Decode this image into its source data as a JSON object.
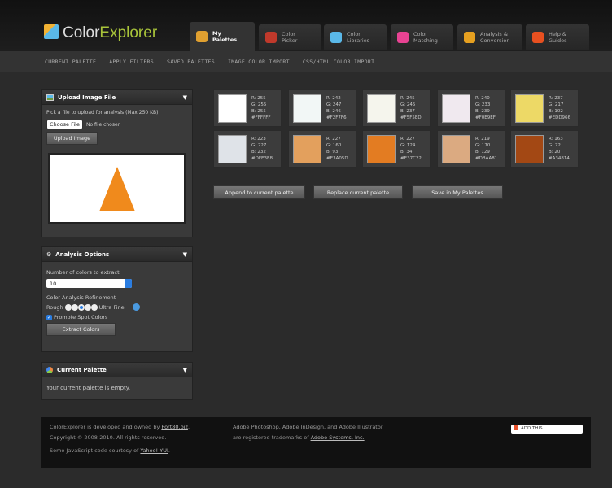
{
  "app": {
    "logo_a": "Color",
    "logo_b": "Explorer"
  },
  "tabs": [
    {
      "l1": "My",
      "l2": "Palettes",
      "color": "#e0a030"
    },
    {
      "l1": "Color",
      "l2": "Picker",
      "color": "#c0392b"
    },
    {
      "l1": "Color",
      "l2": "Libraries",
      "color": "#5ab8e8"
    },
    {
      "l1": "Color",
      "l2": "Matching",
      "color": "#e84393"
    },
    {
      "l1": "Analysis &",
      "l2": "Conversion",
      "color": "#e6a020"
    },
    {
      "l1": "Help &",
      "l2": "Guides",
      "color": "#e85020"
    }
  ],
  "subnav": [
    "CURRENT PALETTE",
    "APPLY FILTERS",
    "SAVED PALETTES",
    "IMAGE COLOR IMPORT",
    "CSS/HTML COLOR IMPORT"
  ],
  "upload": {
    "title": "Upload Image File",
    "hint": "Pick a file to upload for analysis (Max 250 KB)",
    "choose": "Choose File",
    "nofile": "No file chosen",
    "button": "Upload Image"
  },
  "analysis": {
    "title": "Analysis Options",
    "num_label": "Number of colors to extract",
    "num_value": "10",
    "refine_label": "Color Analysis Refinement",
    "rough": "Rough",
    "fine": "Ultra Fine",
    "refine_level": 3,
    "promote": "Promote Spot Colors",
    "extract": "Extract Colors"
  },
  "current": {
    "title": "Current Palette",
    "empty": "Your current palette is empty."
  },
  "swatches": [
    {
      "r": "R: 255",
      "g": "G: 255",
      "b": "B: 255",
      "hex": "#FFFFFF",
      "color": "#FFFFFF"
    },
    {
      "r": "R: 242",
      "g": "G: 247",
      "b": "B: 246",
      "hex": "#F2F7F6",
      "color": "#F2F7F6"
    },
    {
      "r": "R: 245",
      "g": "G: 245",
      "b": "B: 237",
      "hex": "#F5F5ED",
      "color": "#F5F5ED"
    },
    {
      "r": "R: 240",
      "g": "G: 233",
      "b": "B: 239",
      "hex": "#F0E9EF",
      "color": "#F0E9EF"
    },
    {
      "r": "R: 237",
      "g": "G: 217",
      "b": "B: 102",
      "hex": "#EDD966",
      "color": "#EDD966"
    },
    {
      "r": "R: 223",
      "g": "G: 227",
      "b": "B: 232",
      "hex": "#DFE3E8",
      "color": "#DFE3E8"
    },
    {
      "r": "R: 227",
      "g": "G: 160",
      "b": "B: 93",
      "hex": "#E3A05D",
      "color": "#E3A05D"
    },
    {
      "r": "R: 227",
      "g": "G: 124",
      "b": "B: 34",
      "hex": "#E37C22",
      "color": "#E37C22"
    },
    {
      "r": "R: 219",
      "g": "G: 170",
      "b": "B: 129",
      "hex": "#DBAA81",
      "color": "#DBAA81"
    },
    {
      "r": "R: 163",
      "g": "G: 72",
      "b": "B: 20",
      "hex": "#A34814",
      "color": "#A34814"
    }
  ],
  "actions": {
    "append": "Append to current palette",
    "replace": "Replace current palette",
    "save": "Save in My Palettes"
  },
  "footer": {
    "l1": "ColorExplorer is developed and owned by ",
    "l1_link": "Port80.biz",
    "l1_end": ".",
    "l2": "Copyright © 2008-2010. All rights reserved.",
    "l3": "Some JavaScript code courtesy of ",
    "l3_link": "Yahoo! YUI",
    "l3_end": ".",
    "r1": "Adobe Photoshop, Adobe InDesign, and Adobe Illustrator",
    "r2": "are registered trademarks of ",
    "r2_link": "Adobe Systems, Inc.",
    "addthis": "ADD THIS"
  }
}
